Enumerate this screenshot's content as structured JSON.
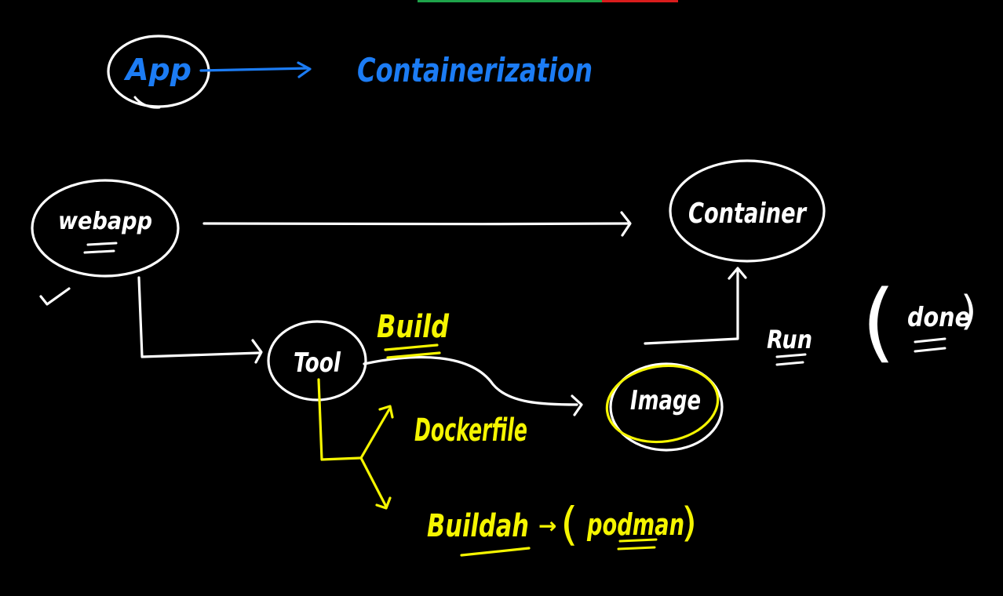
{
  "colors": {
    "background": "#000000",
    "blue": "#1c7cf4",
    "white": "#ffffff",
    "yellow": "#f5f500",
    "bar_green": "#1ea34a",
    "bar_red": "#d91c1c"
  },
  "top_progress": {
    "segments": [
      {
        "color": "#1ea34a",
        "fraction": 0.71
      },
      {
        "color": "#d91c1c",
        "fraction": 0.29
      }
    ]
  },
  "labels": {
    "app": "App",
    "containerization": "Containerization",
    "webapp": "webapp",
    "container": "Container",
    "tool": "Tool",
    "build": "Build",
    "image": "Image",
    "run": "Run",
    "done": "done",
    "dockerfile": "Dockerfile",
    "buildah": "Buildah",
    "podman": "podman",
    "arrow": "→",
    "paren_open": "(",
    "paren_close": ")"
  },
  "icons": {
    "check": "checkmark-icon"
  }
}
